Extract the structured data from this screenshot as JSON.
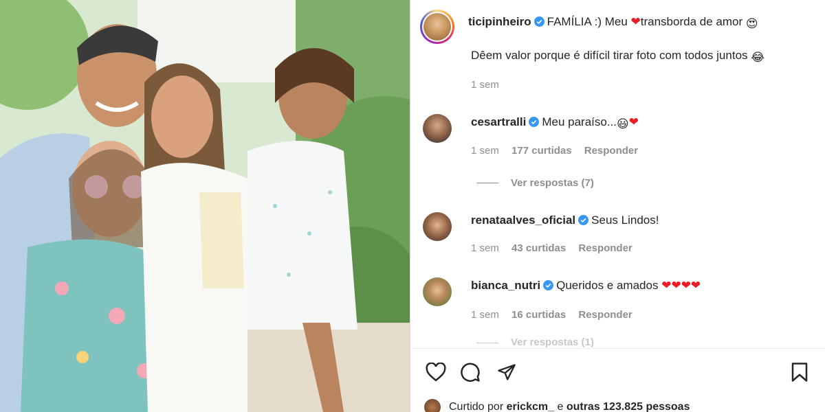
{
  "post": {
    "author": "ticipinheiro",
    "caption_line1": "FAMÍLIA :) Meu",
    "caption_line1_end": "transborda de amor",
    "caption_line2": "Dêem valor porque é difícil tirar foto com todos juntos",
    "time": "1 sem"
  },
  "comments": [
    {
      "user": "cesartralli",
      "text": "Meu paraíso...",
      "time": "1 sem",
      "likes": "177 curtidas",
      "reply": "Responder",
      "view_replies": "Ver respostas (7)"
    },
    {
      "user": "renataalves_oficial",
      "text": "Seus Lindos!",
      "time": "1 sem",
      "likes": "43 curtidas",
      "reply": "Responder"
    },
    {
      "user": "bianca_nutri",
      "text": "Queridos e amados",
      "time": "1 sem",
      "likes": "16 curtidas",
      "reply": "Responder",
      "view_replies": "Ver respostas (1)"
    }
  ],
  "liked_by": {
    "prefix": "Curtido por",
    "user": "erickcm_",
    "middle": "e",
    "others": "outras 123.825 pessoas"
  },
  "icons": [
    "heart-outline-icon",
    "comment-icon",
    "share-icon",
    "bookmark-icon",
    "verified-icon"
  ],
  "colors": {
    "verified": "#3897f0",
    "heart_emoji": "#ed1c24",
    "muted": "#8e8e8e"
  }
}
